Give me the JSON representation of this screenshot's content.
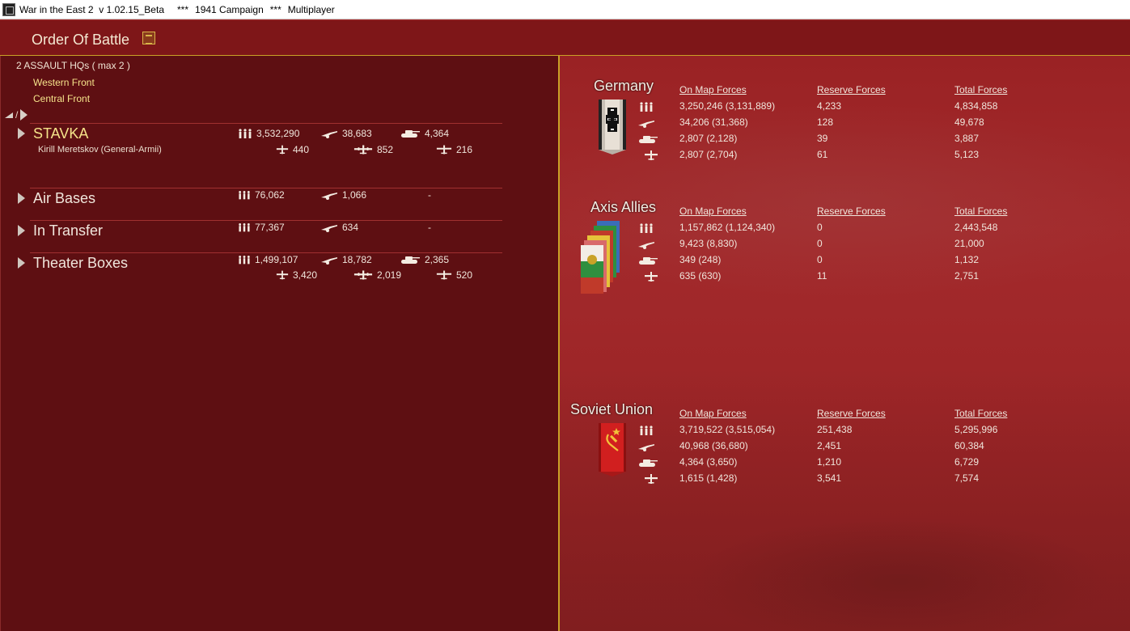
{
  "titlebar": {
    "app": "War in the East 2  v 1.02.15_Beta",
    "sep1": "***",
    "campaign": "1941 Campaign",
    "sep2": "***",
    "mode": "Multiplayer"
  },
  "header": {
    "title": "Order Of Battle",
    "icon": "notepad-icon"
  },
  "left": {
    "hq_count": "2 ASSAULT HQs ( max 2 )",
    "fronts": [
      "Western Front",
      "Central Front"
    ],
    "nav_separator": "/",
    "rows": [
      {
        "name": "STAVKA",
        "commander": "Kirill Meretskov  (General-Armii)",
        "men": "3,532,290",
        "guns": "38,683",
        "afv": "4,364",
        "fighters": "440",
        "bombers": "852",
        "other_air": "216"
      },
      {
        "name": "Air Bases",
        "men": "76,062",
        "guns": "1,066",
        "afv": "-"
      },
      {
        "name": "In Transfer",
        "men": "77,367",
        "guns": "634",
        "afv": "-"
      },
      {
        "name": "Theater Boxes",
        "men": "1,499,107",
        "guns": "18,782",
        "afv": "2,365",
        "fighters": "3,420",
        "bombers": "2,019",
        "other_air": "520"
      }
    ]
  },
  "right": {
    "columns": [
      "On Map Forces",
      "Reserve Forces",
      "Total Forces"
    ],
    "nations": [
      {
        "name": "Germany",
        "rows": [
          {
            "icon": "men-icon",
            "onmap": "3,250,246 (3,131,889)",
            "reserve": "4,233",
            "total": "4,834,858"
          },
          {
            "icon": "gun-icon",
            "onmap": "34,206 (31,368)",
            "reserve": "128",
            "total": "49,678"
          },
          {
            "icon": "tank-icon",
            "onmap": "2,807 (2,128)",
            "reserve": "39",
            "total": "3,887"
          },
          {
            "icon": "aircraft-icon",
            "onmap": "2,807 (2,704)",
            "reserve": "61",
            "total": "5,123"
          }
        ]
      },
      {
        "name": "Axis Allies",
        "rows": [
          {
            "icon": "men-icon",
            "onmap": "1,157,862 (1,124,340)",
            "reserve": "0",
            "total": "2,443,548"
          },
          {
            "icon": "gun-icon",
            "onmap": "9,423 (8,830)",
            "reserve": "0",
            "total": "21,000"
          },
          {
            "icon": "tank-icon",
            "onmap": "349 (248)",
            "reserve": "0",
            "total": "1,132"
          },
          {
            "icon": "aircraft-icon",
            "onmap": "635 (630)",
            "reserve": "11",
            "total": "2,751"
          }
        ]
      },
      {
        "name": "Soviet Union",
        "rows": [
          {
            "icon": "men-icon",
            "onmap": "3,719,522 (3,515,054)",
            "reserve": "251,438",
            "total": "5,295,996"
          },
          {
            "icon": "gun-icon",
            "onmap": "40,968 (36,680)",
            "reserve": "2,451",
            "total": "60,384"
          },
          {
            "icon": "tank-icon",
            "onmap": "4,364 (3,650)",
            "reserve": "1,210",
            "total": "6,729"
          },
          {
            "icon": "aircraft-icon",
            "onmap": "1,615 (1,428)",
            "reserve": "3,541",
            "total": "7,574"
          }
        ]
      }
    ]
  },
  "colors": {
    "panel": "#5e0f12",
    "accent": "#c9a227",
    "gold_text": "#f5e38a",
    "background": "#9a2224"
  }
}
